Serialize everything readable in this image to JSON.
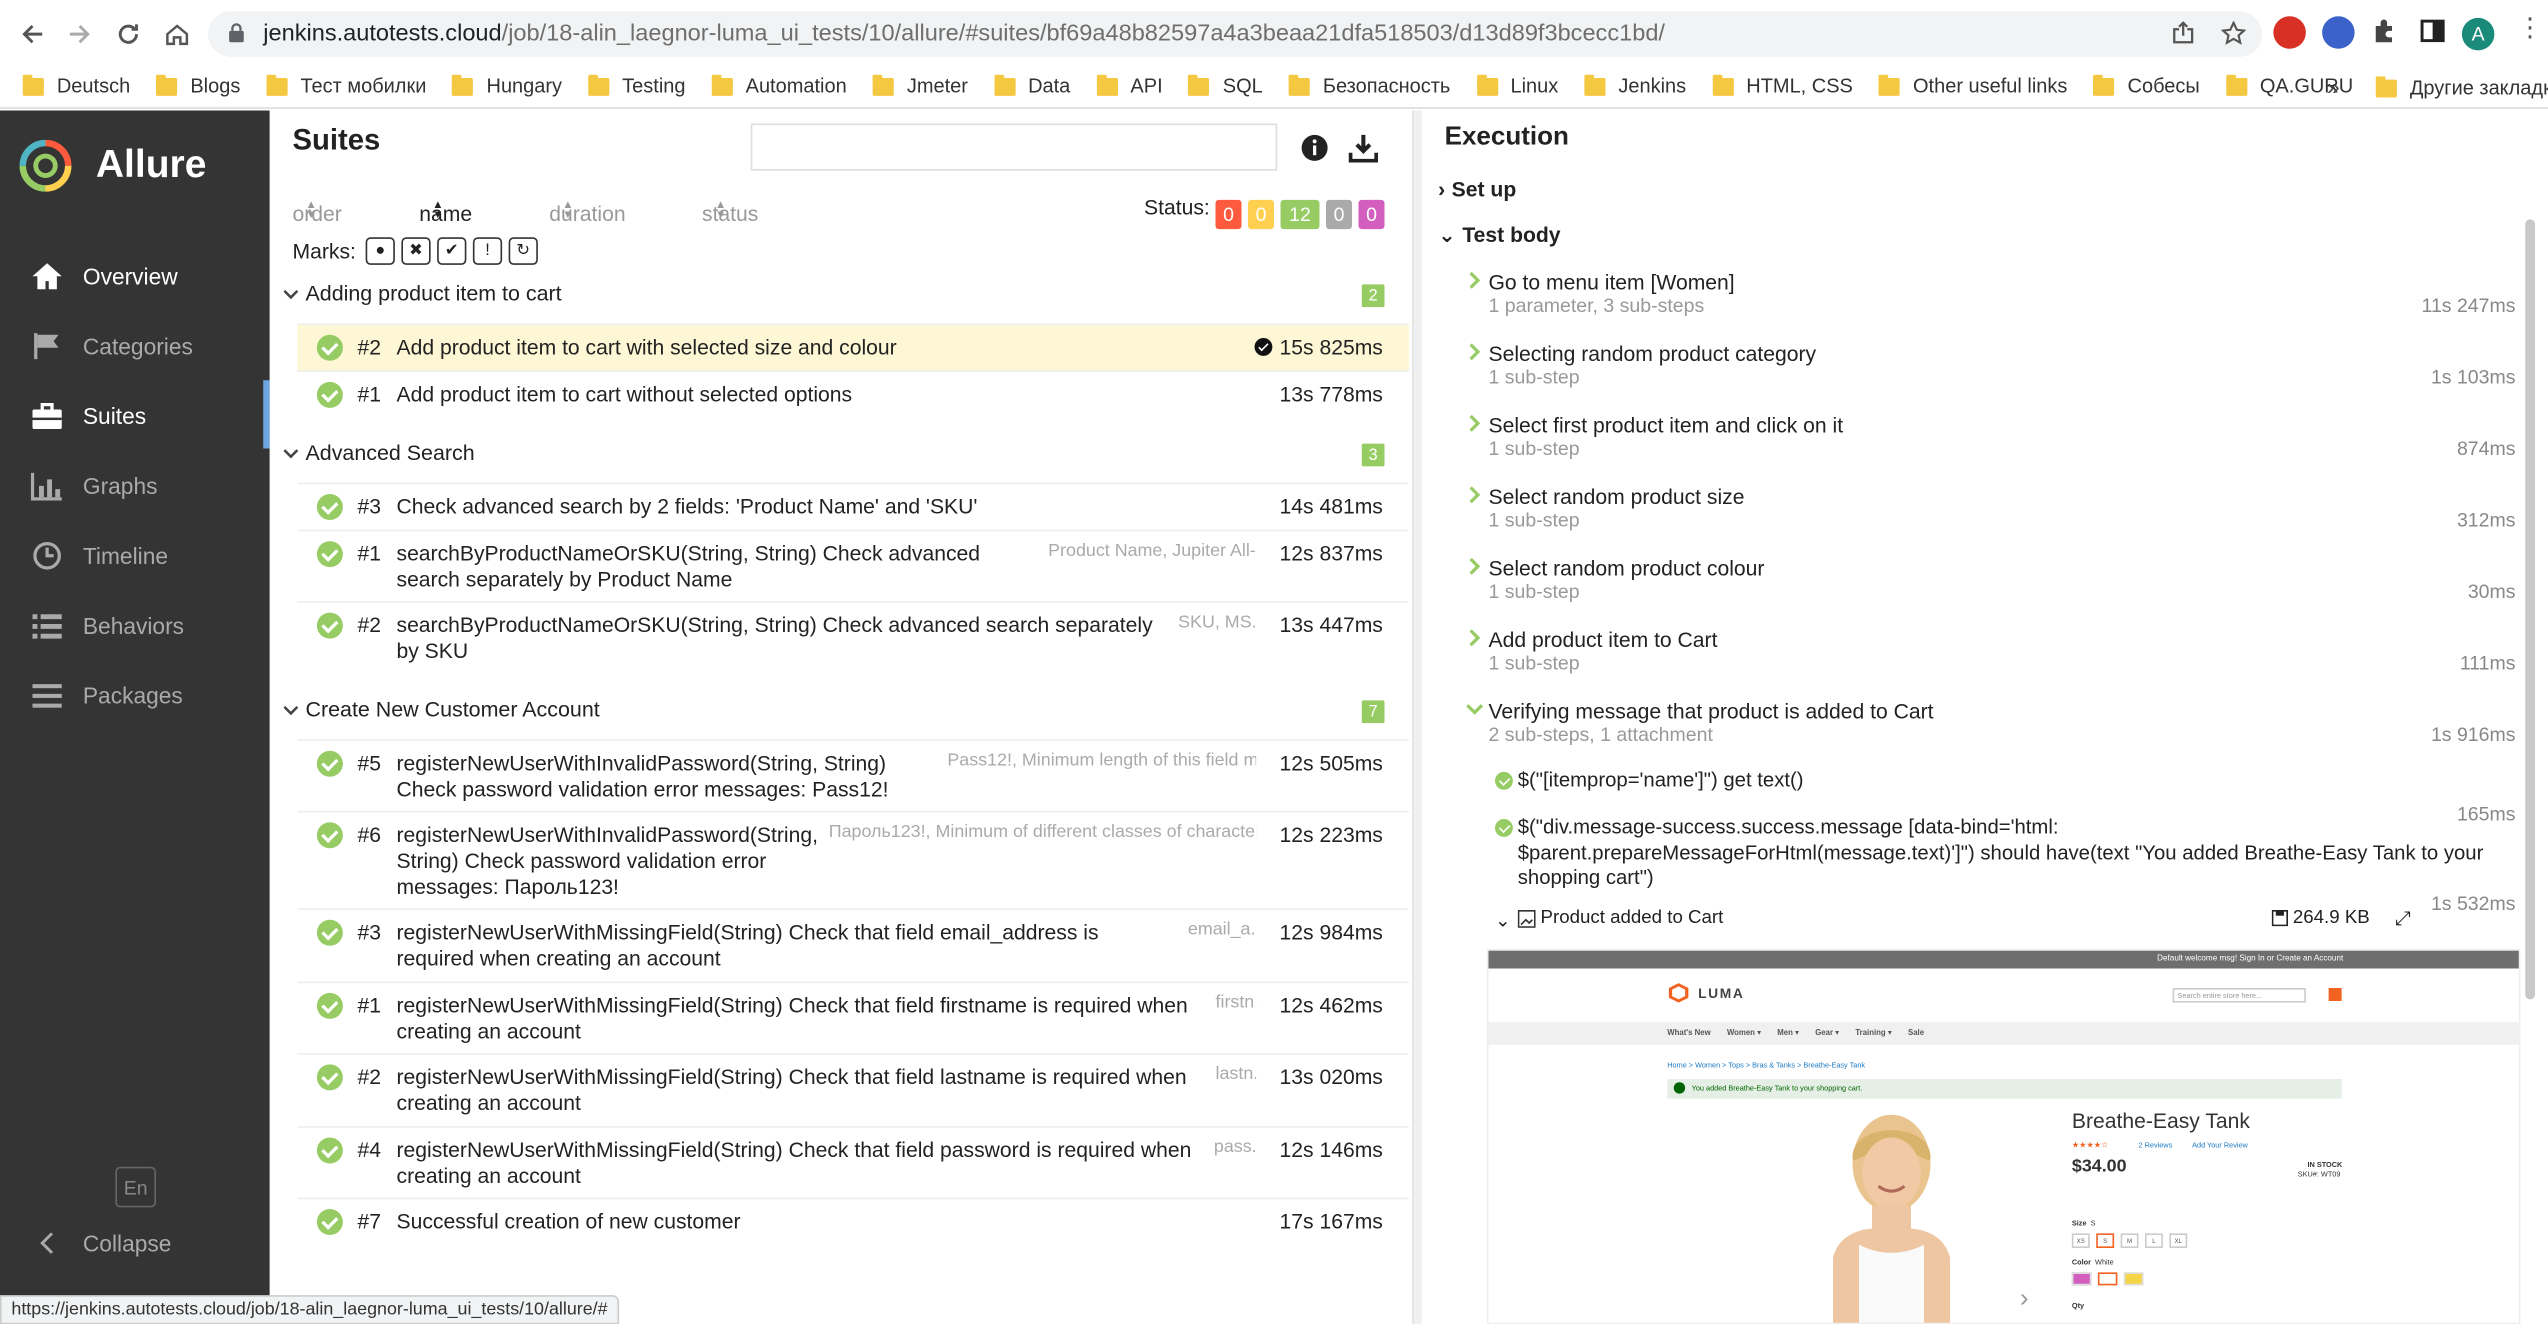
{
  "browser": {
    "url_host": "jenkins.autotests.cloud",
    "url_path": "/job/18-alin_laegnor-luma_ui_tests/10/allure/#suites/bf69a48b82597a4a3beaa21dfa518503/d13d89f3bcecc1bd/",
    "status_url": "https://jenkins.autotests.cloud/job/18-alin_laegnor-luma_ui_tests/10/allure/#",
    "profile_initial": "A",
    "bookmarks": [
      "Deutsch",
      "Blogs",
      "Тест мобилки",
      "Hungary",
      "Testing",
      "Automation",
      "Jmeter",
      "Data",
      "API",
      "SQL",
      "Безопасность",
      "Linux",
      "Jenkins",
      "HTML, CSS",
      "Other useful links",
      "Собесы",
      "QA.GURU"
    ],
    "more_label": "»",
    "other_bookmarks": "Другие закладки"
  },
  "sidebar": {
    "app_name": "Allure",
    "items": [
      {
        "label": "Overview",
        "icon": "home-icon"
      },
      {
        "label": "Categories",
        "icon": "flag-icon"
      },
      {
        "label": "Suites",
        "icon": "briefcase-icon"
      },
      {
        "label": "Graphs",
        "icon": "bar-chart-icon"
      },
      {
        "label": "Timeline",
        "icon": "clock-icon"
      },
      {
        "label": "Behaviors",
        "icon": "list-icon"
      },
      {
        "label": "Packages",
        "icon": "menu-icon"
      }
    ],
    "language": "En",
    "collapse": "Collapse"
  },
  "suites": {
    "title": "Suites",
    "search_placeholder": "",
    "sort": {
      "order": "order",
      "name": "name",
      "duration": "duration",
      "status": "status"
    },
    "status_label": "Status:",
    "status_counts": [
      {
        "value": "0",
        "color": "#fd5a3e"
      },
      {
        "value": "0",
        "color": "#ffd050"
      },
      {
        "value": "12",
        "color": "#97cc64"
      },
      {
        "value": "0",
        "color": "#aaaaaa"
      },
      {
        "value": "0",
        "color": "#d35ebe"
      }
    ],
    "marks_label": "Marks:",
    "groups": [
      {
        "name": "Adding product item to cart",
        "count": "2"
      },
      {
        "name": "Advanced Search",
        "count": "3"
      },
      {
        "name": "Create New Customer Account",
        "count": "7"
      }
    ],
    "tests": [
      {
        "num": "#2",
        "name": "Add product item to cart with selected size and colour",
        "params": "",
        "duration": "15s 825ms"
      },
      {
        "num": "#1",
        "name": "Add product item to cart without selected options",
        "params": "",
        "duration": "13s 778ms"
      },
      {
        "num": "#3",
        "name": "Check advanced search by 2 fields: 'Product Name' and 'SKU'",
        "params": "",
        "duration": "14s 481ms"
      },
      {
        "num": "#1",
        "name": "searchByProductNameOrSKU(String, String) Check advanced search separately by Product Name",
        "params": "Product Name, Jupiter All-...",
        "duration": "12s 837ms"
      },
      {
        "num": "#2",
        "name": "searchByProductNameOrSKU(String, String) Check advanced search separately by SKU",
        "params": "SKU, MS...",
        "duration": "13s 447ms"
      },
      {
        "num": "#5",
        "name": "registerNewUserWithInvalidPassword(String, String) Check password validation error messages: Pass12!",
        "params": "Pass12!, Minimum length of this field m...",
        "duration": "12s 505ms"
      },
      {
        "num": "#6",
        "name": "registerNewUserWithInvalidPassword(String, String) Check password validation error messages: Пароль123!",
        "params": "Пароль123!, Minimum of different classes of character...",
        "duration": "12s 223ms"
      },
      {
        "num": "#3",
        "name": "registerNewUserWithMissingField(String) Check that field email_address is required when creating an account",
        "params": "email_a...",
        "duration": "12s 984ms"
      },
      {
        "num": "#1",
        "name": "registerNewUserWithMissingField(String) Check that field firstname is required when creating an account",
        "params": "firstn...",
        "duration": "12s 462ms"
      },
      {
        "num": "#2",
        "name": "registerNewUserWithMissingField(String) Check that field lastname is required when creating an account",
        "params": "lastn...",
        "duration": "13s 020ms"
      },
      {
        "num": "#4",
        "name": "registerNewUserWithMissingField(String) Check that field password is required when creating an account",
        "params": "pass...",
        "duration": "12s 146ms"
      },
      {
        "num": "#7",
        "name": "Successful creation of new customer",
        "params": "",
        "duration": "17s 167ms"
      }
    ]
  },
  "execution": {
    "title": "Execution",
    "setup": "Set up",
    "body": "Test body",
    "steps": [
      {
        "title": "Go to menu item [Women]",
        "sub": "1 parameter, 3 sub-steps",
        "duration": "11s 247ms"
      },
      {
        "title": "Selecting random product category",
        "sub": "1 sub-step",
        "duration": "1s 103ms"
      },
      {
        "title": "Select first product item and click on it",
        "sub": "1 sub-step",
        "duration": "874ms"
      },
      {
        "title": "Select random product size",
        "sub": "1 sub-step",
        "duration": "312ms"
      },
      {
        "title": "Select random product colour",
        "sub": "1 sub-step",
        "duration": "30ms"
      },
      {
        "title": "Add product item to Cart",
        "sub": "1 sub-step",
        "duration": "111ms"
      },
      {
        "title": "Verifying message that product is added to Cart",
        "sub": "2 sub-steps, 1 attachment",
        "duration": "1s 916ms"
      }
    ],
    "substeps": [
      {
        "text": "$(\"[itemprop='name']\") get text()",
        "duration": "165ms"
      },
      {
        "text": "$(\"div.message-success.success.message [data-bind='html: $parent.prepareMessageForHtml(message.text)']\") should have(text \"You added Breathe-Easy Tank to your shopping cart\")",
        "duration": "1s 532ms"
      }
    ],
    "attachment": {
      "name": "Product added to Cart",
      "size": "264.9 KB"
    },
    "screenshot": {
      "top_links": "Default welcome msg!   Sign In   or   Create an Account",
      "brand": "LUMA",
      "search_placeholder": "Search entire store here...",
      "menu": [
        "What's New",
        "Women ▾",
        "Men ▾",
        "Gear ▾",
        "Training ▾",
        "Sale"
      ],
      "crumbs": "Home  >  Women  >  Tops  >  Bras & Tanks  >  Breathe-Easy Tank",
      "message": "You added Breathe-Easy Tank to your shopping cart.",
      "product_name": "Breathe-Easy Tank",
      "reviews": "2 Reviews",
      "add_review": "Add Your Review",
      "price": "$34.00",
      "stock": "IN STOCK",
      "sku": "SKU#: WT09",
      "size_label": "Size",
      "size_value": "S",
      "sizes": [
        "XS",
        "S",
        "M",
        "L",
        "XL"
      ],
      "color_label": "Color",
      "color_value": "White",
      "swatches": [
        "#d35ebe",
        "#ffffff",
        "#f5d547"
      ],
      "qty_label": "Qty"
    }
  }
}
